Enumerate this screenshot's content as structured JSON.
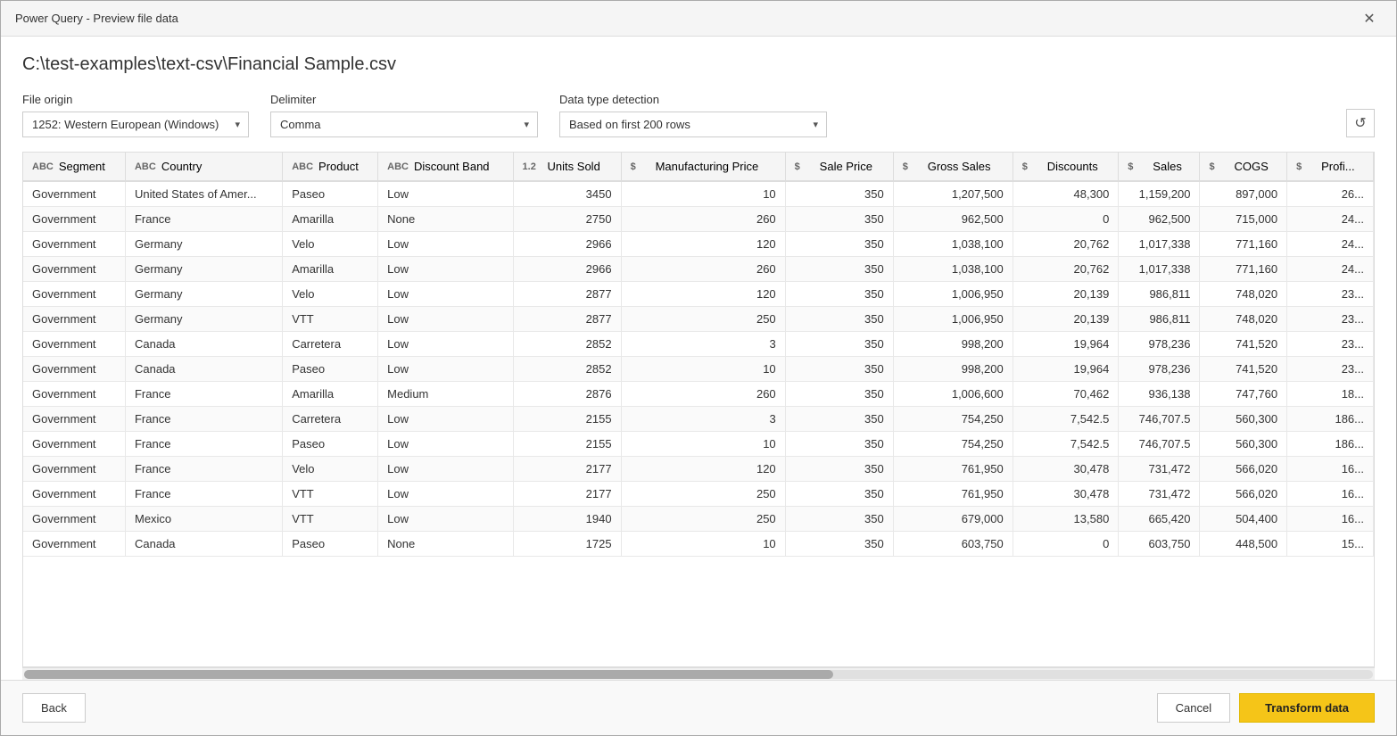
{
  "window": {
    "title": "Power Query - Preview file data",
    "close_label": "✕"
  },
  "file_path": "C:\\test-examples\\text-csv\\Financial Sample.csv",
  "options": {
    "file_origin_label": "File origin",
    "file_origin_value": "1252: Western European (Windows)",
    "delimiter_label": "Delimiter",
    "delimiter_value": "Comma",
    "datatype_label": "Data type detection",
    "datatype_value": "Based on first 200 rows"
  },
  "columns": [
    {
      "name": "Segment",
      "type": "ABC",
      "align": "left"
    },
    {
      "name": "Country",
      "type": "ABC",
      "align": "left"
    },
    {
      "name": "Product",
      "type": "ABC",
      "align": "left"
    },
    {
      "name": "Discount Band",
      "type": "ABC",
      "align": "left"
    },
    {
      "name": "Units Sold",
      "type": "1.2",
      "align": "right"
    },
    {
      "name": "Manufacturing Price",
      "type": "$",
      "align": "right"
    },
    {
      "name": "Sale Price",
      "type": "$",
      "align": "right"
    },
    {
      "name": "Gross Sales",
      "type": "$",
      "align": "right"
    },
    {
      "name": "Discounts",
      "type": "$",
      "align": "right"
    },
    {
      "name": "Sales",
      "type": "$",
      "align": "right"
    },
    {
      "name": "COGS",
      "type": "$",
      "align": "right"
    },
    {
      "name": "Profi...",
      "type": "$",
      "align": "right"
    }
  ],
  "rows": [
    [
      "Government",
      "United States of Amer...",
      "Paseo",
      "Low",
      "3450",
      "10",
      "350",
      "1,207,500",
      "48,300",
      "1,159,200",
      "897,000",
      "26..."
    ],
    [
      "Government",
      "France",
      "Amarilla",
      "None",
      "2750",
      "260",
      "350",
      "962,500",
      "0",
      "962,500",
      "715,000",
      "24..."
    ],
    [
      "Government",
      "Germany",
      "Velo",
      "Low",
      "2966",
      "120",
      "350",
      "1,038,100",
      "20,762",
      "1,017,338",
      "771,160",
      "24..."
    ],
    [
      "Government",
      "Germany",
      "Amarilla",
      "Low",
      "2966",
      "260",
      "350",
      "1,038,100",
      "20,762",
      "1,017,338",
      "771,160",
      "24..."
    ],
    [
      "Government",
      "Germany",
      "Velo",
      "Low",
      "2877",
      "120",
      "350",
      "1,006,950",
      "20,139",
      "986,811",
      "748,020",
      "23..."
    ],
    [
      "Government",
      "Germany",
      "VTT",
      "Low",
      "2877",
      "250",
      "350",
      "1,006,950",
      "20,139",
      "986,811",
      "748,020",
      "23..."
    ],
    [
      "Government",
      "Canada",
      "Carretera",
      "Low",
      "2852",
      "3",
      "350",
      "998,200",
      "19,964",
      "978,236",
      "741,520",
      "23..."
    ],
    [
      "Government",
      "Canada",
      "Paseo",
      "Low",
      "2852",
      "10",
      "350",
      "998,200",
      "19,964",
      "978,236",
      "741,520",
      "23..."
    ],
    [
      "Government",
      "France",
      "Amarilla",
      "Medium",
      "2876",
      "260",
      "350",
      "1,006,600",
      "70,462",
      "936,138",
      "747,760",
      "18..."
    ],
    [
      "Government",
      "France",
      "Carretera",
      "Low",
      "2155",
      "3",
      "350",
      "754,250",
      "7,542.5",
      "746,707.5",
      "560,300",
      "186..."
    ],
    [
      "Government",
      "France",
      "Paseo",
      "Low",
      "2155",
      "10",
      "350",
      "754,250",
      "7,542.5",
      "746,707.5",
      "560,300",
      "186..."
    ],
    [
      "Government",
      "France",
      "Velo",
      "Low",
      "2177",
      "120",
      "350",
      "761,950",
      "30,478",
      "731,472",
      "566,020",
      "16..."
    ],
    [
      "Government",
      "France",
      "VTT",
      "Low",
      "2177",
      "250",
      "350",
      "761,950",
      "30,478",
      "731,472",
      "566,020",
      "16..."
    ],
    [
      "Government",
      "Mexico",
      "VTT",
      "Low",
      "1940",
      "250",
      "350",
      "679,000",
      "13,580",
      "665,420",
      "504,400",
      "16..."
    ],
    [
      "Government",
      "Canada",
      "Paseo",
      "None",
      "1725",
      "10",
      "350",
      "603,750",
      "0",
      "603,750",
      "448,500",
      "15..."
    ]
  ],
  "footer": {
    "back_label": "Back",
    "cancel_label": "Cancel",
    "transform_label": "Transform data"
  }
}
